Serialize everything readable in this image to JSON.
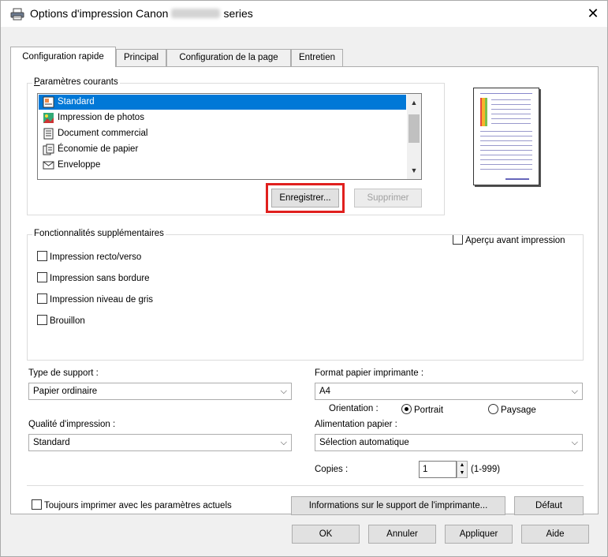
{
  "window": {
    "title_prefix": "Options d'impression Canon",
    "title_suffix": "series",
    "close_glyph": "✕"
  },
  "tabs": [
    {
      "label": "Configuration rapide",
      "active": true
    },
    {
      "label": "Principal",
      "active": false
    },
    {
      "label": "Configuration de la page",
      "active": false
    },
    {
      "label": "Entretien",
      "active": false
    }
  ],
  "current_settings": {
    "group_label": "Paramètres courants",
    "items": [
      {
        "label": "Standard",
        "icon": "standard-icon",
        "selected": true
      },
      {
        "label": "Impression de photos",
        "icon": "photo-icon",
        "selected": false
      },
      {
        "label": "Document commercial",
        "icon": "document-icon",
        "selected": false
      },
      {
        "label": "Économie de papier",
        "icon": "paper-saving-icon",
        "selected": false
      },
      {
        "label": "Enveloppe",
        "icon": "envelope-icon",
        "selected": false
      }
    ],
    "save_button": "Enregistrer...",
    "delete_button": "Supprimer"
  },
  "preview": {
    "checkbox_label": "Aperçu avant impression"
  },
  "additional_features": {
    "group_label": "Fonctionnalités supplémentaires",
    "items": [
      {
        "label": "Impression recto/verso",
        "checked": false
      },
      {
        "label": "Impression sans bordure",
        "checked": false
      },
      {
        "label": "Impression niveau de gris",
        "checked": false
      },
      {
        "label": "Brouillon",
        "checked": false
      }
    ]
  },
  "media_type": {
    "label": "Type de support :",
    "value": "Papier ordinaire"
  },
  "paper_size": {
    "label": "Format papier imprimante :",
    "value": "A4"
  },
  "orientation": {
    "label": "Orientation :",
    "portrait": "Portrait",
    "landscape": "Paysage",
    "selected": "portrait"
  },
  "print_quality": {
    "label": "Qualité d'impression :",
    "value": "Standard"
  },
  "paper_source": {
    "label": "Alimentation papier :",
    "value": "Sélection automatique"
  },
  "copies": {
    "label": "Copies :",
    "value": "1",
    "range": "(1-999)"
  },
  "always_print": {
    "label": "Toujours imprimer avec les paramètres actuels",
    "checked": false
  },
  "media_info_button": "Informations sur le support de l'imprimante...",
  "default_button": "Défaut",
  "footer": {
    "ok": "OK",
    "cancel": "Annuler",
    "apply": "Appliquer",
    "help": "Aide"
  },
  "colors": {
    "accent": "#0078d7",
    "highlight": "#e0201e"
  }
}
